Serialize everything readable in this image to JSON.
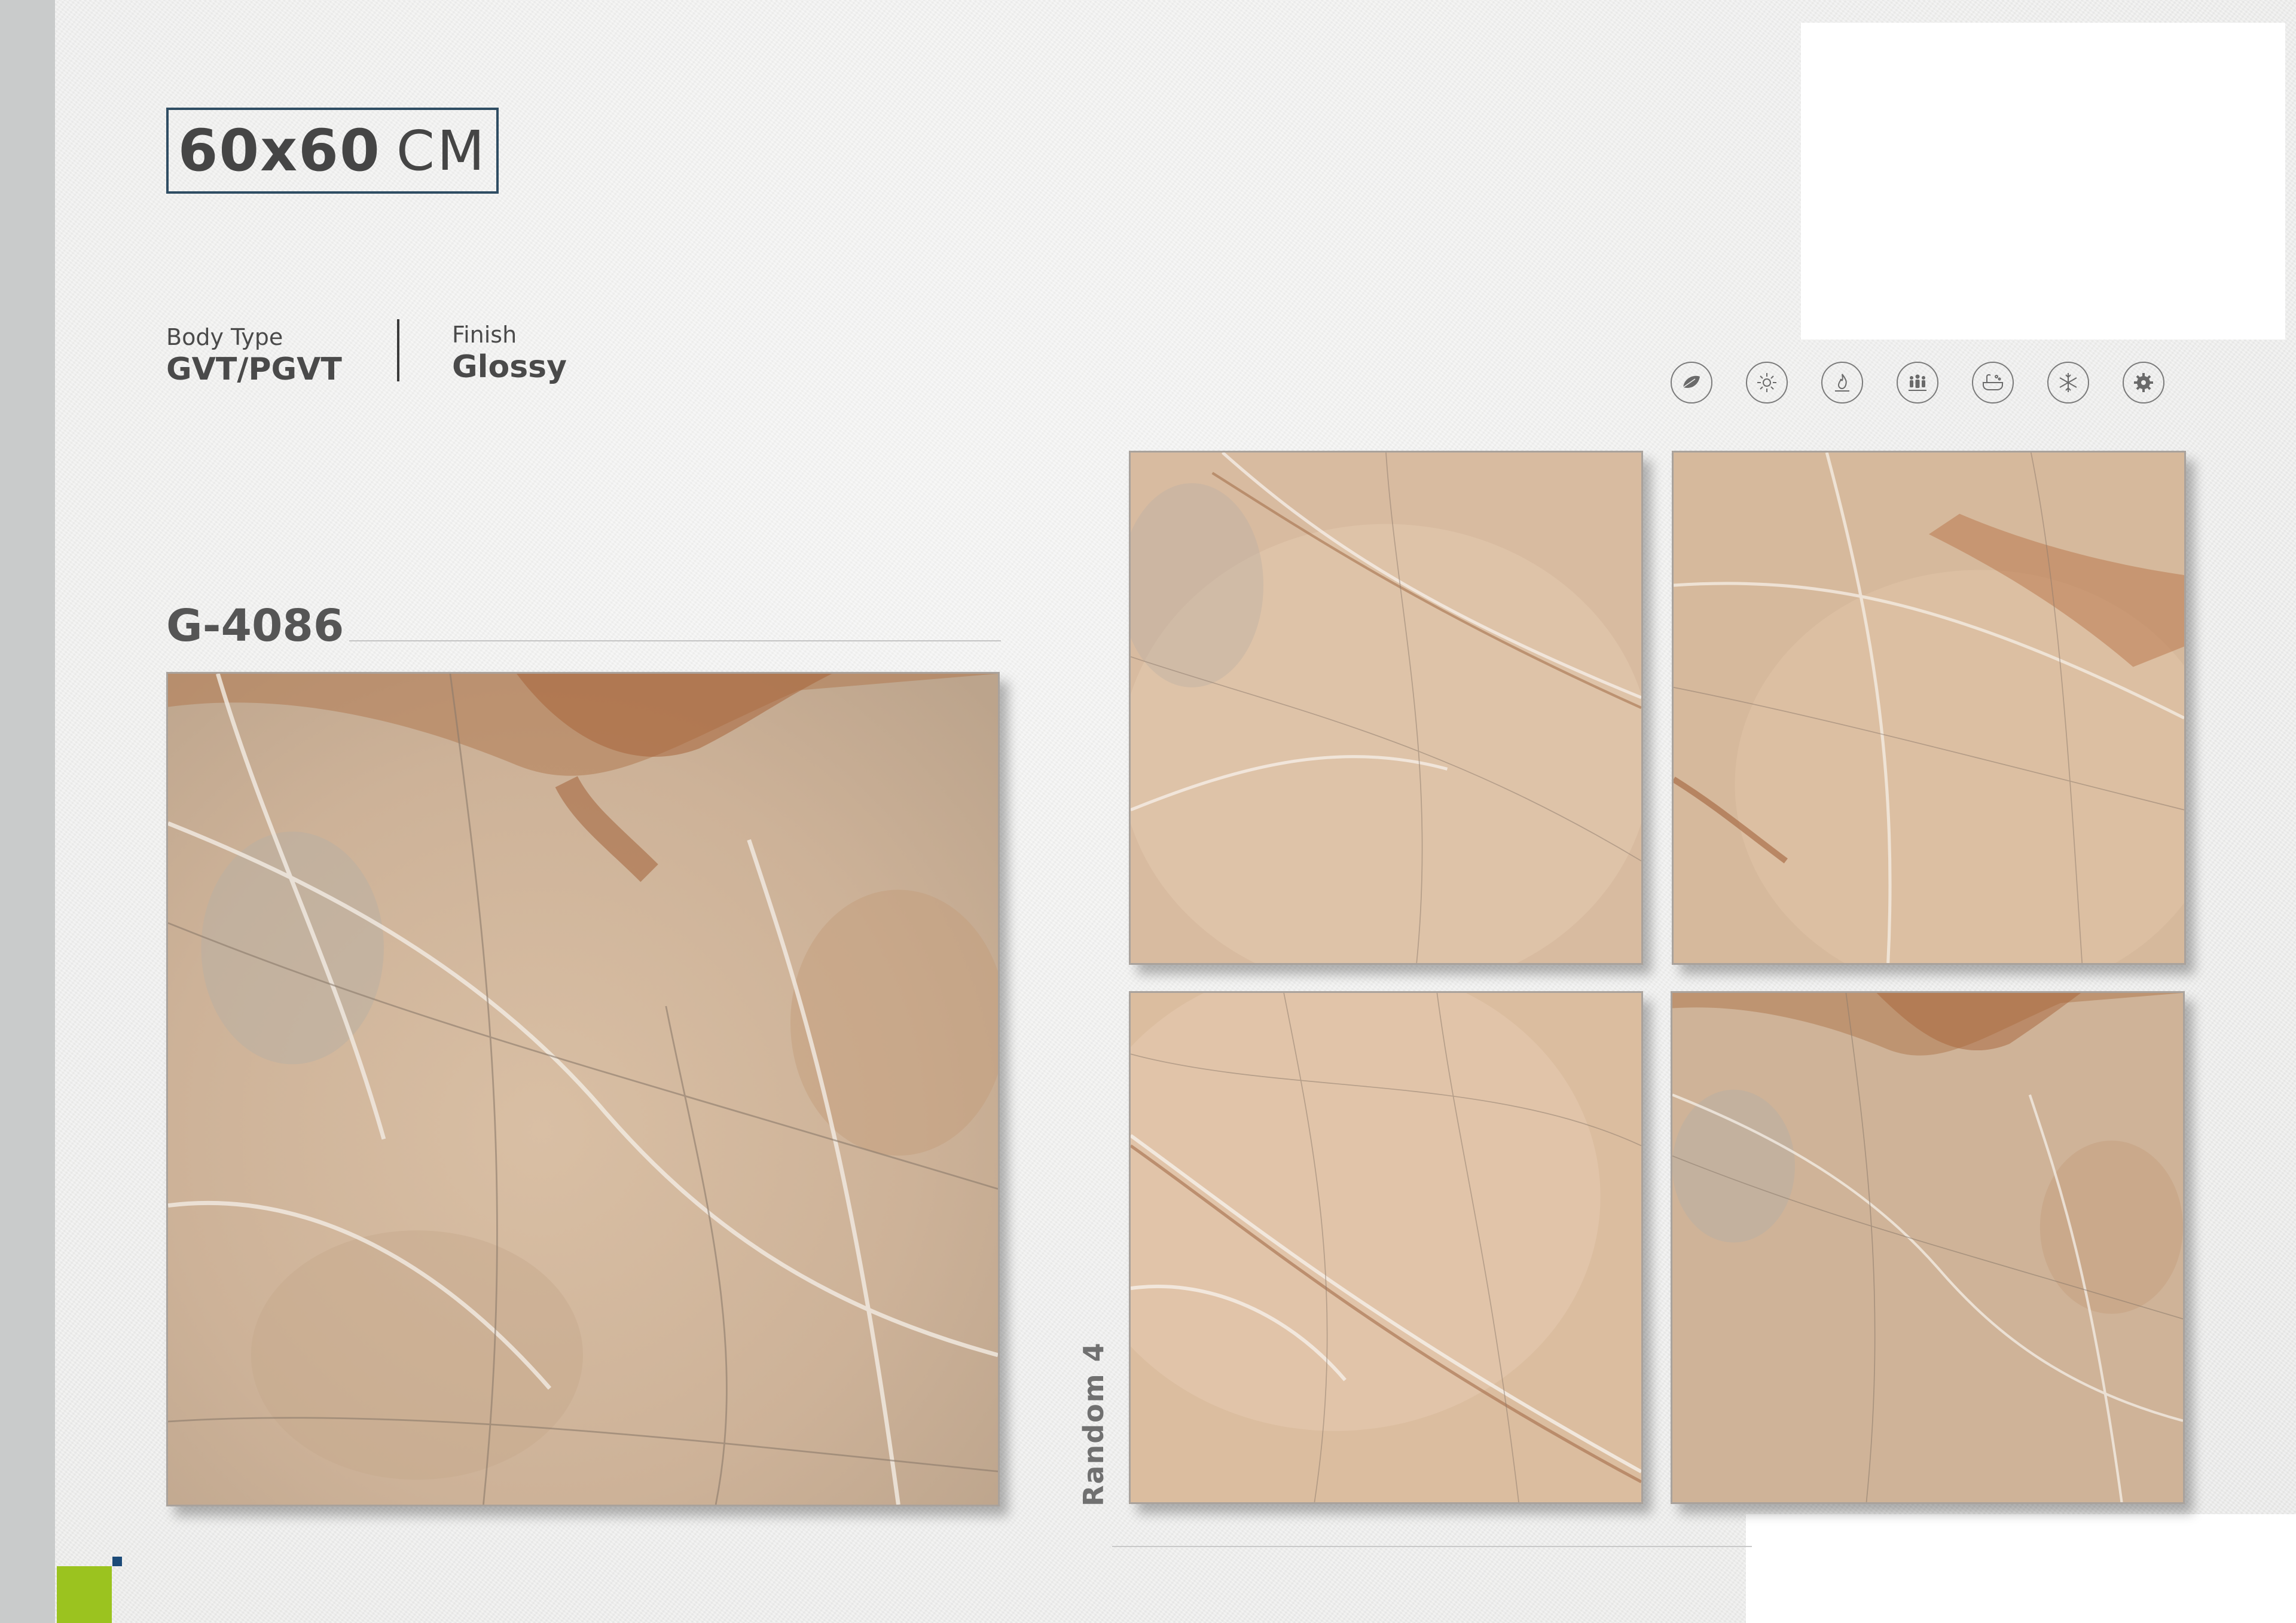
{
  "header": {
    "size_number": "60x60",
    "size_unit": "CM"
  },
  "specs": {
    "body_type_label": "Body Type",
    "body_type_value": "GVT/PGVT",
    "finish_label": "Finish",
    "finish_value": "Glossy"
  },
  "product": {
    "code": "G-4086",
    "random_label": "Random 4"
  },
  "feature_icons": [
    "leaf-icon",
    "sun-icon",
    "fire-resistant-icon",
    "people-icon",
    "bathtub-icon",
    "snowflake-icon",
    "gear-icon"
  ],
  "colors": {
    "frame_border": "#2f4d63",
    "left_bar": "#c9cbcb",
    "accent_green": "#9bc31f",
    "accent_blue": "#1b4a78",
    "text_dark": "#4a4a4a"
  }
}
